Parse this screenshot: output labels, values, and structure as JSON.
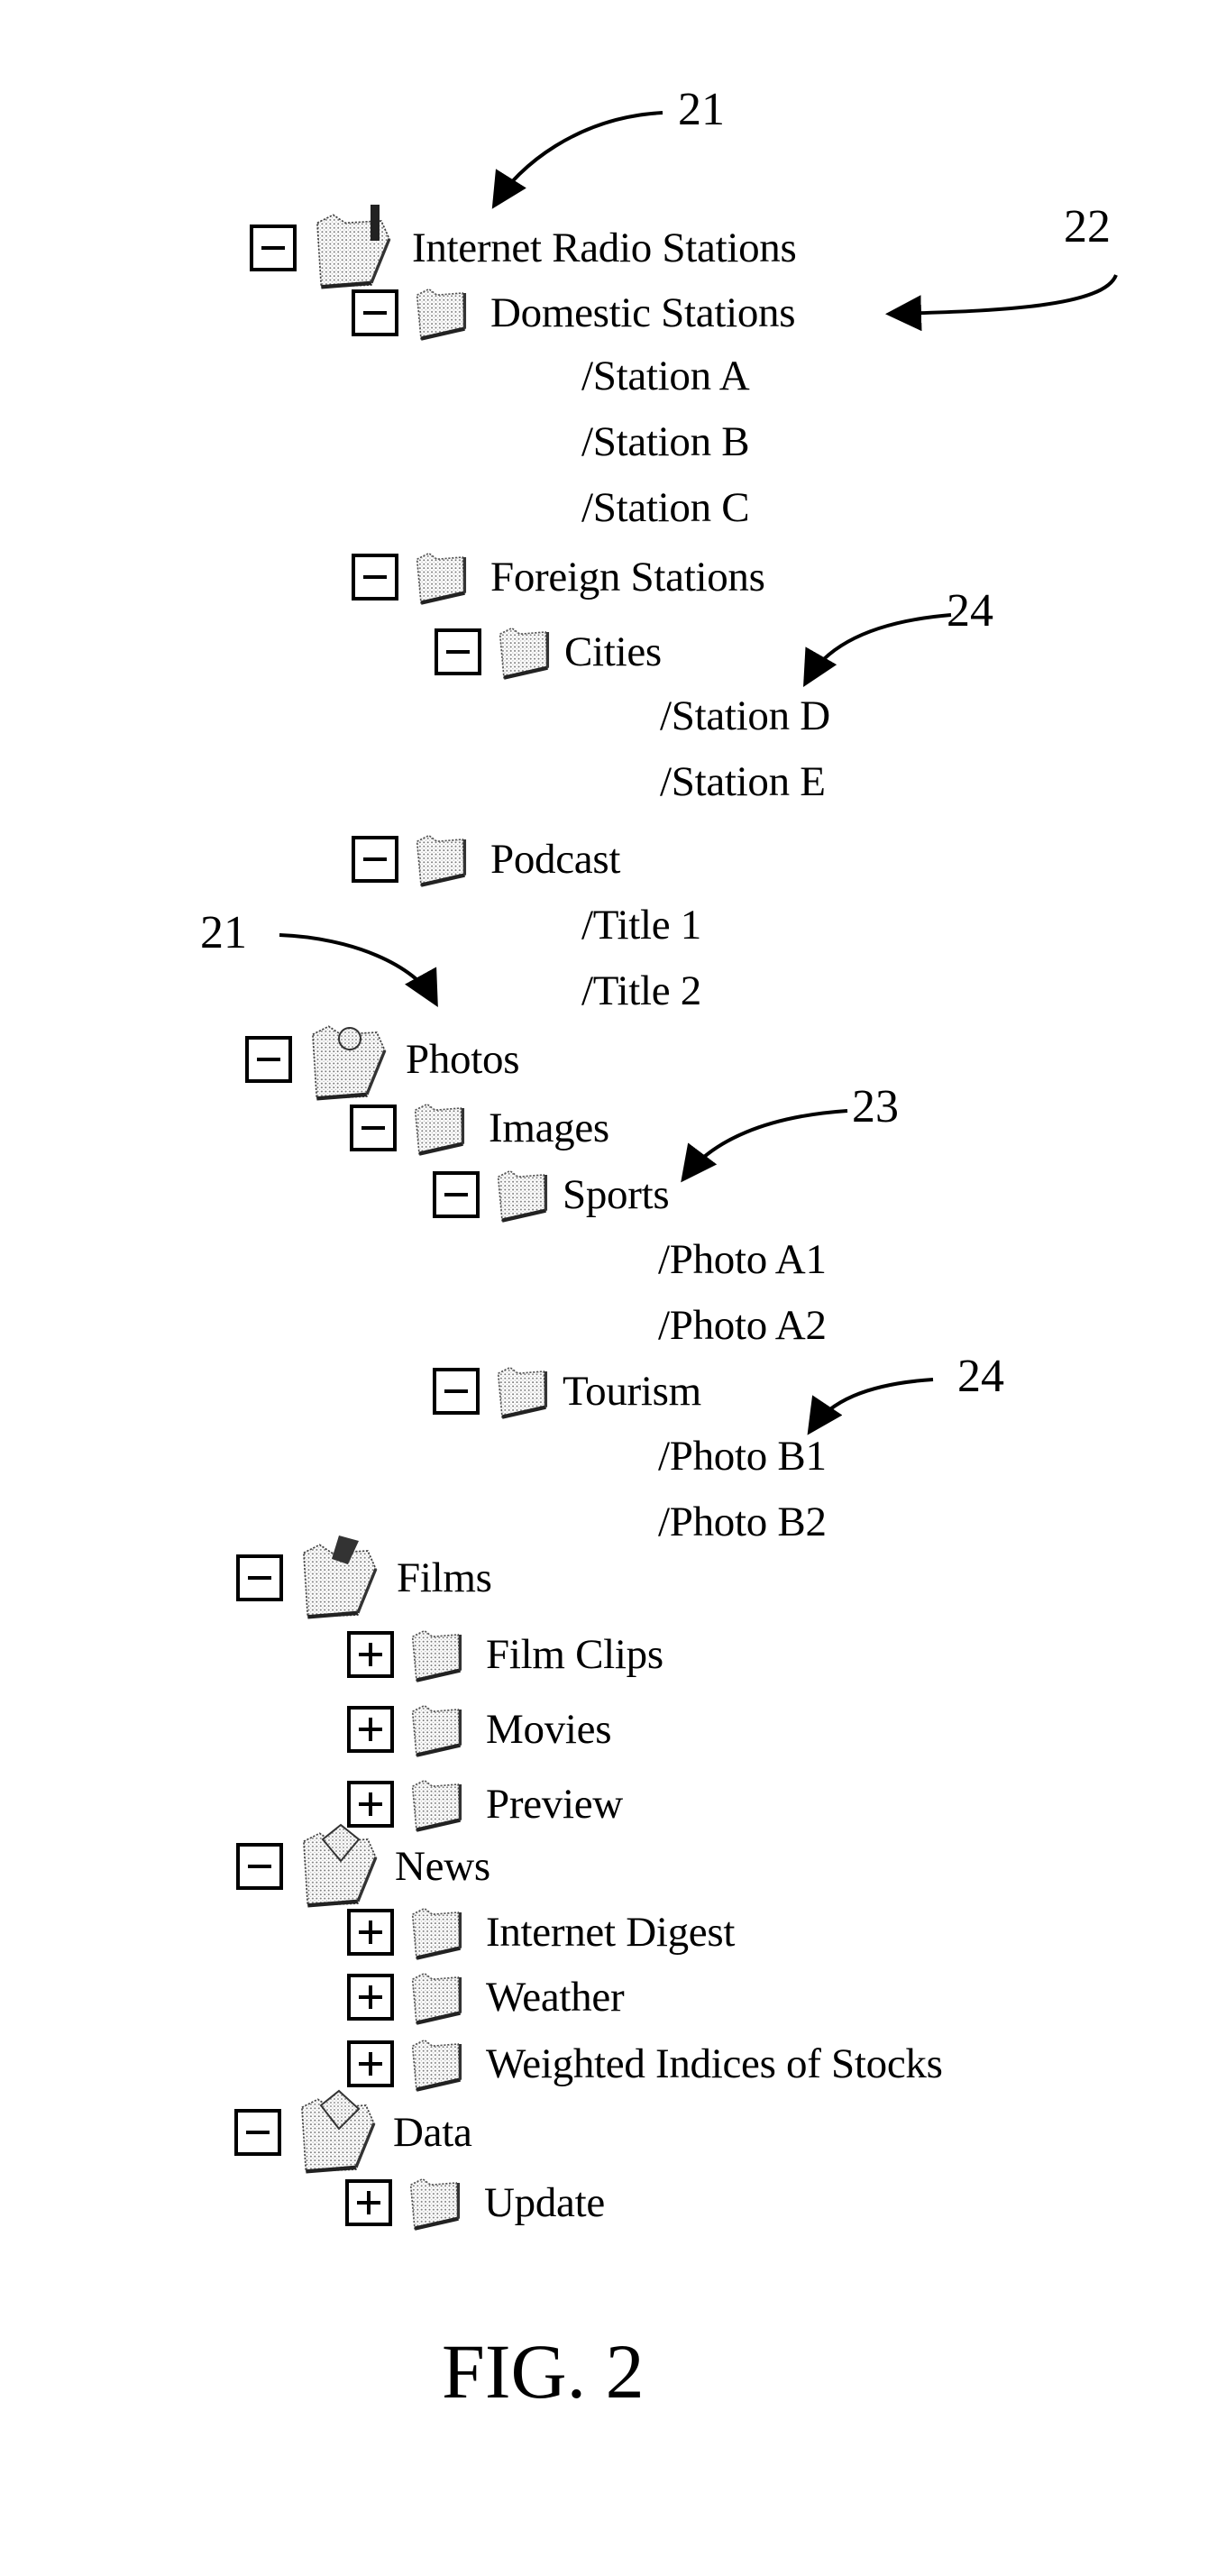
{
  "figure_label": "FIG. 2",
  "reference_numerals": {
    "root_category_a": "21",
    "subcategory": "22",
    "root_category_b": "21",
    "sub_subcategory": "23",
    "leaf_group_a": "24",
    "leaf_group_b": "24"
  },
  "tree": {
    "internet_radio": {
      "label": "Internet Radio Stations",
      "icon": "radio-folder-icon",
      "state": "expanded",
      "domestic": {
        "label": "Domestic Stations",
        "state": "expanded",
        "items": [
          "/Station A",
          "/Station B",
          "/Station C"
        ]
      },
      "foreign": {
        "label": "Foreign Stations",
        "state": "expanded",
        "cities": {
          "label": "Cities",
          "state": "expanded",
          "items": [
            "/Station D",
            "/Station E"
          ]
        }
      },
      "podcast": {
        "label": "Podcast",
        "state": "expanded",
        "items": [
          "/Title 1",
          "/Title 2"
        ]
      }
    },
    "photos": {
      "label": "Photos",
      "icon": "photo-folder-icon",
      "state": "expanded",
      "images": {
        "label": "Images",
        "state": "expanded",
        "sports": {
          "label": "Sports",
          "state": "expanded",
          "items": [
            "/Photo A1",
            "/Photo A2"
          ]
        },
        "tourism": {
          "label": "Tourism",
          "state": "expanded",
          "items": [
            "/Photo B1",
            "/Photo B2"
          ]
        }
      }
    },
    "films": {
      "label": "Films",
      "icon": "film-folder-icon",
      "state": "expanded",
      "children": [
        {
          "label": "Film Clips",
          "state": "collapsed"
        },
        {
          "label": "Movies",
          "state": "collapsed"
        },
        {
          "label": "Preview",
          "state": "collapsed"
        }
      ]
    },
    "news": {
      "label": "News",
      "icon": "news-folder-icon",
      "state": "expanded",
      "children": [
        {
          "label": "Internet Digest",
          "state": "collapsed"
        },
        {
          "label": "Weather",
          "state": "collapsed"
        },
        {
          "label": "Weighted Indices of Stocks",
          "state": "collapsed"
        }
      ]
    },
    "data": {
      "label": "Data",
      "icon": "data-folder-icon",
      "state": "expanded",
      "children": [
        {
          "label": "Update",
          "state": "collapsed"
        }
      ]
    }
  }
}
